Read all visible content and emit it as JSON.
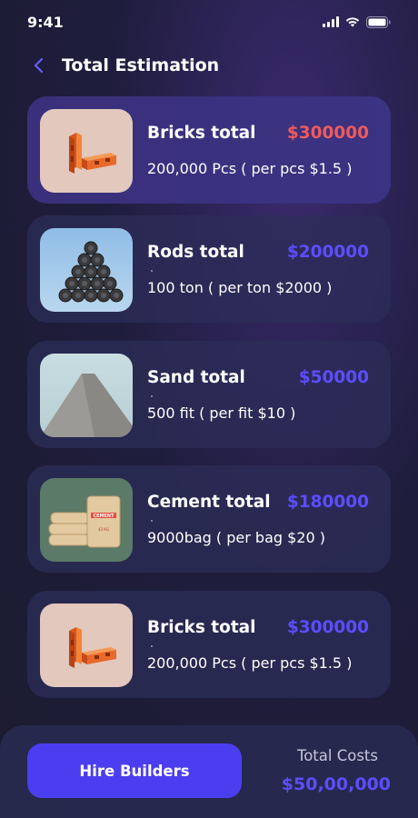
{
  "status_bar": {
    "time": "9:41"
  },
  "header": {
    "title": "Total Estimation"
  },
  "items": [
    {
      "name": "Bricks total",
      "price": "$300000",
      "detail": "200,000 Pcs ( per pcs $1.5 )",
      "image": "bricks"
    },
    {
      "name": "Rods total",
      "price": "$200000",
      "detail": "100 ton ( per ton $2000 )",
      "image": "rods"
    },
    {
      "name": "Sand total",
      "price": "$50000",
      "detail": "500 fit  ( per fit $10 )",
      "image": "sand"
    },
    {
      "name": "Cement total",
      "price": "$180000",
      "detail": "9000bag ( per bag $20 )",
      "image": "cement"
    },
    {
      "name": "Bricks total",
      "price": "$300000",
      "detail": "200,000 Pcs ( per pcs $1.5 )",
      "image": "bricks"
    }
  ],
  "footer": {
    "hire_label": "Hire Builders",
    "total_label": "Total Costs",
    "total_value": "$50,00,000"
  },
  "colors": {
    "accent": "#4b3ef0",
    "price_highlight": "#f05a5a",
    "price": "#5c4dff"
  }
}
